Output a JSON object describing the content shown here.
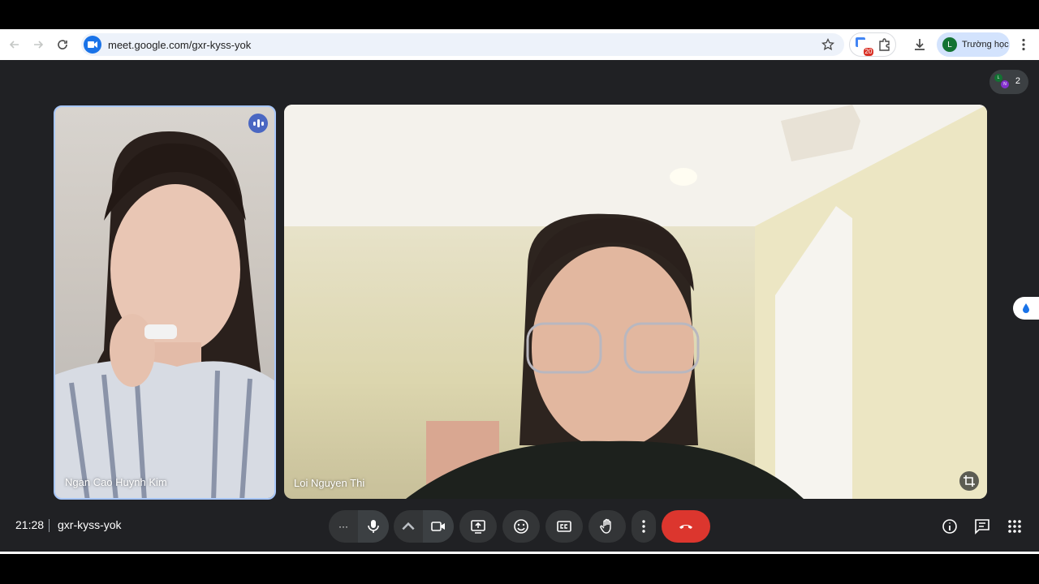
{
  "browser": {
    "url": "meet.google.com/gxr-kyss-yok",
    "badge_count": "20",
    "profile_initial": "L",
    "profile_name": "Trường học"
  },
  "meet": {
    "participants_count": "2",
    "tiles": [
      {
        "name": "Ngan Cao Huynh Kim"
      },
      {
        "name": "Loi Nguyen Thi"
      }
    ],
    "time": "21:28",
    "meeting_code": "gxr-kyss-yok",
    "more_label": "···",
    "colors": {
      "end_call": "#dc362e",
      "speaking_border": "#a8c7fa",
      "bg": "#202124"
    }
  }
}
